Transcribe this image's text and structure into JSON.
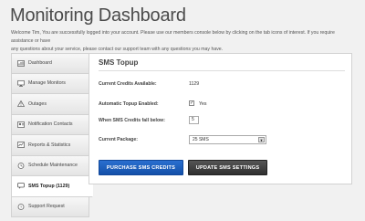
{
  "header": {
    "title": "Monitoring Dashboard",
    "welcome_line1": "Welcome Tim, You are successfully logged into your account. Please use our members console below by clicking on the tab icons of interest. If you require assistance or have",
    "welcome_line2": "any questions about your service, please contact our support team with any questions you may have."
  },
  "sidebar": {
    "items": [
      {
        "label": "Dashboard",
        "icon": "dashboard-icon"
      },
      {
        "label": "Manage Monitors",
        "icon": "monitor-icon"
      },
      {
        "label": "Outages",
        "icon": "outage-icon"
      },
      {
        "label": "Notification Contacts",
        "icon": "contacts-icon"
      },
      {
        "label": "Reports & Statistics",
        "icon": "reports-icon"
      },
      {
        "label": "Schedule Maintenance",
        "icon": "schedule-icon"
      },
      {
        "label": "SMS Topup (1129)",
        "icon": "sms-icon",
        "active": true
      },
      {
        "label": "Support Request",
        "icon": "support-icon"
      }
    ]
  },
  "main": {
    "section_title": "SMS Topup",
    "credits_label": "Current Credits Available:",
    "credits_value": "1129",
    "auto_topup_label": "Automatic Topup Enabled:",
    "auto_topup_value": "Yes",
    "auto_topup_checked": true,
    "threshold_label": "When SMS Credits fall below:",
    "threshold_value": "5",
    "package_label": "Current Package:",
    "package_value": "25 SMS",
    "purchase_button": "PURCHASE SMS CREDITS",
    "update_button": "UPDATE SMS SETTINGS"
  },
  "colors": {
    "primary_button": "#1a5cbf",
    "secondary_button": "#3a3a3a",
    "background": "#f1f1f1"
  }
}
